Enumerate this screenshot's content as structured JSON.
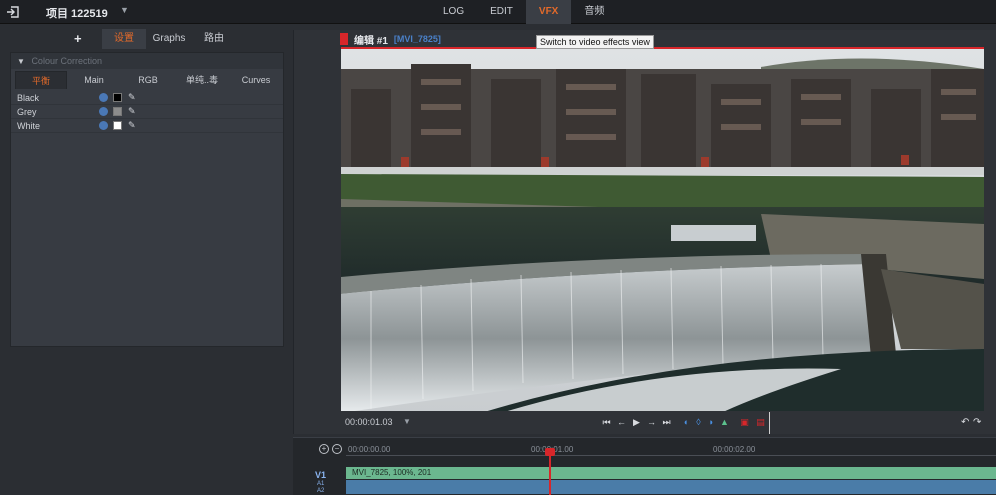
{
  "topbar": {
    "project_title": "项目 122519",
    "project_dropdown": "▼",
    "tabs": [
      {
        "label": "LOG"
      },
      {
        "label": "EDIT"
      },
      {
        "label": "VFX"
      },
      {
        "label": "音频"
      }
    ]
  },
  "left_panel": {
    "add_button": "+",
    "tabs": [
      {
        "label": "设置"
      },
      {
        "label": "Graphs"
      },
      {
        "label": "路由"
      }
    ],
    "colour_correction": {
      "title": "Colour Correction",
      "tabs": [
        {
          "label": "平衡"
        },
        {
          "label": "Main"
        },
        {
          "label": "RGB"
        },
        {
          "label": "单纯..毒"
        },
        {
          "label": "Curves"
        }
      ],
      "rows": [
        {
          "label": "Black",
          "swatch": "#000000"
        },
        {
          "label": "Grey",
          "swatch": "#8c8c8c"
        },
        {
          "label": "White",
          "swatch": "#ffffff"
        }
      ]
    }
  },
  "viewer": {
    "title": "编辑 #1",
    "clip_name": "[MVI_7825]",
    "tooltip": "Switch to video effects view",
    "timecode": "00:00:01.03",
    "timecode_dropdown": "▼"
  },
  "timeline": {
    "ruler_labels": [
      "00:00:00.00",
      "00:00:01.00",
      "00:00:02.00"
    ],
    "video_track": "V1",
    "audio_tracks": [
      "A1",
      "A2"
    ],
    "clip_label": "MVI_7825, 100%, 201"
  },
  "colors": {
    "accent": "#e36a2a",
    "marker_red": "#d8262a",
    "clip_green": "#6bb78f",
    "audio_blue": "#4a7ca8"
  }
}
